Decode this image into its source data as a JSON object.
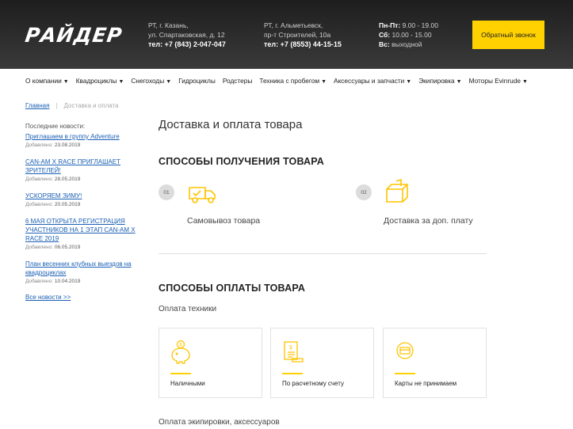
{
  "header": {
    "logo": "РАЙДЕР",
    "address1": {
      "line1": "РТ, г. Казань,",
      "line2": "ул. Спартаковская, д. 12",
      "phone": "тел: +7 (843) 2-047-047"
    },
    "address2": {
      "line1": "РТ, г. Альметьевск,",
      "line2": "пр-т Строителей, 10а",
      "phone": "тел: +7 (8553) 44-15-15"
    },
    "hours": [
      {
        "day": "Пн-Пт:",
        "time": "9.00 - 19.00"
      },
      {
        "day": "Сб:",
        "time": "10.00 - 15.00"
      },
      {
        "day": "Вс:",
        "time": "выходной"
      }
    ],
    "callback_label": "Обратный звонок"
  },
  "nav": [
    {
      "label": "О компании",
      "arrow": "▼"
    },
    {
      "label": "Квадроциклы",
      "arrow": "▼"
    },
    {
      "label": "Снегоходы",
      "arrow": "▼"
    },
    {
      "label": "Гидроциклы",
      "arrow": ""
    },
    {
      "label": "Родстеры",
      "arrow": ""
    },
    {
      "label": "Техника с пробегом",
      "arrow": "▼"
    },
    {
      "label": "Аксессуары и запчасти",
      "arrow": "▼"
    },
    {
      "label": "Экипировка",
      "arrow": "▼"
    },
    {
      "label": "Моторы Evinrude",
      "arrow": "▼"
    }
  ],
  "breadcrumb": {
    "home": "Главная",
    "sep": "|",
    "current": "Доставка и оплата"
  },
  "sidebar": {
    "heading": "Последние новости:",
    "added_label": "Добавлено:",
    "news": [
      {
        "title": "Приглашаем в группу Adventure",
        "date": "23.08.2019"
      },
      {
        "title": "CAN-AM X RACE ПРИГЛАШАЕТ ЗРИТЕЛЕЙ!",
        "date": "28.05.2019"
      },
      {
        "title": "УСКОРЯЕМ ЗИМУ!",
        "date": "20.05.2019"
      },
      {
        "title": "6 МАЯ ОТКРЫТА РЕГИСТРАЦИЯ УЧАСТНИКОВ НА 1 ЭТАП CAN-AM X RACE 2019",
        "date": "06.05.2019"
      },
      {
        "title": "План весенних клубных выездов на квадроциклах",
        "date": "10.04.2019"
      }
    ],
    "all_news": "Все новости >>"
  },
  "main": {
    "title": "Доставка и оплата товара",
    "receive_title": "СПОСОБЫ ПОЛУЧЕНИЯ ТОВАРА",
    "receive": [
      {
        "num": "01",
        "label": "Самовывоз товара",
        "icon": "truck-icon"
      },
      {
        "num": "02",
        "label": "Доставка за доп. плату",
        "icon": "box-icon"
      }
    ],
    "payment_title": "СПОСОБЫ ОПЛАТЫ ТОВАРА",
    "vehicles_subtitle": "Оплата техники",
    "payments": [
      {
        "label": "Наличными",
        "icon": "piggy-bank-icon"
      },
      {
        "label": "По расчетному счету",
        "icon": "invoice-icon"
      },
      {
        "label": "Карты не принимаем",
        "icon": "card-icon"
      }
    ],
    "gear_subtitle": "Оплата экипировки, аксессуаров"
  },
  "colors": {
    "accent": "#ffd100",
    "header_bg": "#2b2b2b",
    "link": "#1a5fb4"
  }
}
